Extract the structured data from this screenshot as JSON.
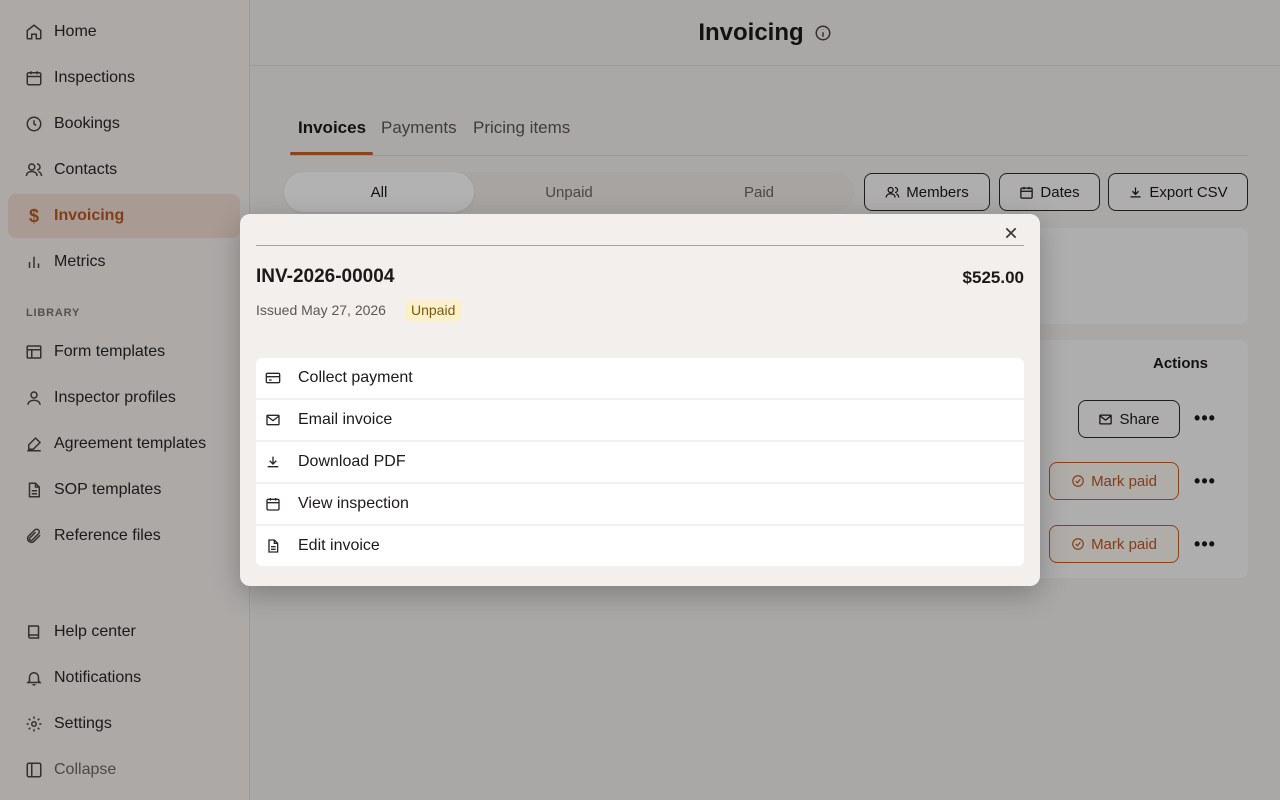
{
  "sidebar": {
    "items": [
      {
        "label": "Home",
        "icon": "home-icon"
      },
      {
        "label": "Inspections",
        "icon": "calendar-icon"
      },
      {
        "label": "Bookings",
        "icon": "clock-icon"
      },
      {
        "label": "Contacts",
        "icon": "users-icon"
      },
      {
        "label": "Invoicing",
        "icon": "dollar-icon"
      },
      {
        "label": "Metrics",
        "icon": "bar-chart-icon"
      }
    ],
    "library_label": "LIBRARY",
    "library_items": [
      {
        "label": "Form templates",
        "icon": "layout-icon"
      },
      {
        "label": "Inspector profiles",
        "icon": "user-icon"
      },
      {
        "label": "Agreement templates",
        "icon": "signature-icon"
      },
      {
        "label": "SOP templates",
        "icon": "document-icon"
      },
      {
        "label": "Reference files",
        "icon": "paperclip-icon"
      }
    ],
    "bottom_items": [
      {
        "label": "Help center",
        "icon": "book-icon"
      },
      {
        "label": "Notifications",
        "icon": "bell-icon"
      },
      {
        "label": "Settings",
        "icon": "gear-icon"
      },
      {
        "label": "Collapse",
        "icon": "collapse-icon"
      }
    ]
  },
  "header": {
    "title": "Invoicing"
  },
  "tabs": [
    "Invoices",
    "Payments",
    "Pricing items"
  ],
  "filters": {
    "segments": [
      "All",
      "Unpaid",
      "Paid"
    ]
  },
  "toolbar": {
    "members": "Members",
    "dates": "Dates",
    "export": "Export CSV"
  },
  "table": {
    "actions_header": "Actions",
    "share_label": "Share",
    "mark_paid_label": "Mark paid",
    "more_label": "•••"
  },
  "modal": {
    "close_glyph": "×",
    "invoice_number": "INV-2026-00004",
    "amount": "$525.00",
    "issued": "Issued May 27, 2026",
    "status": "Unpaid",
    "actions": [
      {
        "label": "Collect payment",
        "icon": "credit-card-icon"
      },
      {
        "label": "Email invoice",
        "icon": "mail-icon"
      },
      {
        "label": "Download PDF",
        "icon": "download-icon"
      },
      {
        "label": "View inspection",
        "icon": "calendar-icon"
      },
      {
        "label": "Edit invoice",
        "icon": "file-text-icon"
      }
    ]
  },
  "colors": {
    "accent": "#c4612a",
    "active_bg": "#f2dfd3",
    "badge_bg": "#fbf0c9"
  }
}
